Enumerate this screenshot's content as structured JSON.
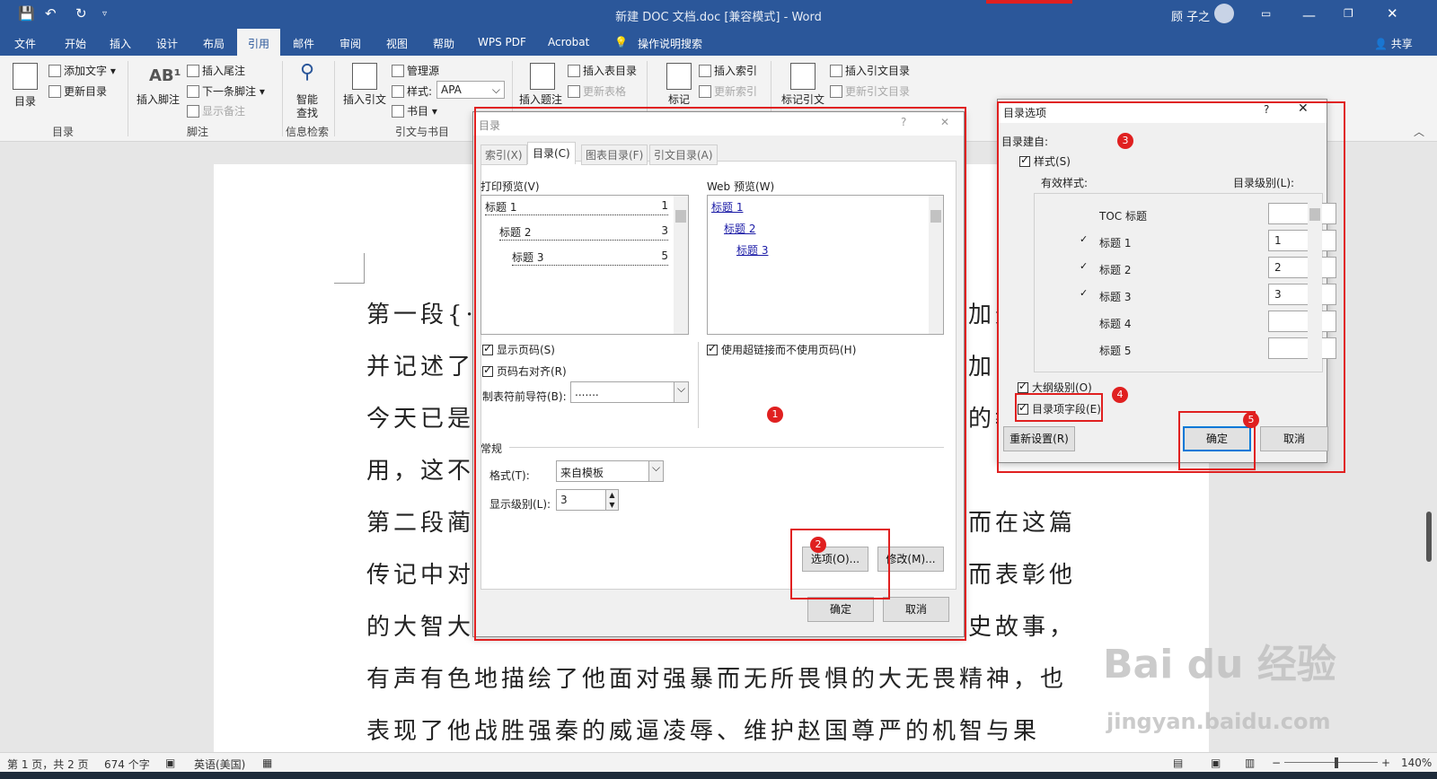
{
  "titlebar": {
    "title": "新建 DOC 文档.doc [兼容模式]  -  Word",
    "user": "顾 子之"
  },
  "menu": [
    "文件",
    "开始",
    "插入",
    "设计",
    "布局",
    "引用",
    "邮件",
    "审阅",
    "视图",
    "帮助",
    "WPS PDF",
    "Acrobat",
    "操作说明搜索"
  ],
  "share": "共享",
  "ribbon": {
    "toc": "目录",
    "add_text": "添加文字",
    "update_toc": "更新目录",
    "g_toc": "目录",
    "insert_footnote": "插入脚注",
    "insert_endnote": "插入尾注",
    "next_footnote": "下一条脚注",
    "show_notes": "显示备注",
    "g_footnote": "脚注",
    "smart1": "智能",
    "smart2": "查找",
    "g_research": "信息检索",
    "insert_citation": "插入引文",
    "manage_sources": "管理源",
    "style_label": "样式:",
    "style_value": "APA",
    "bibliography": "书目",
    "g_citation": "引文与书目",
    "insert_caption": "插入题注",
    "insert_tof": "插入表目录",
    "update_table": "更新表格",
    "mark": "标记",
    "insert_index": "插入索引",
    "update_index": "更新索引",
    "mark_citation": "标记引文",
    "insert_toa": "插入引文目录",
    "update_toa": "更新引文目录"
  },
  "doc_lines": [
    "第一段{·",
    "并记述了",
    "今天已是",
    "用，这不",
    "第二段蔺",
    "传记中对",
    "的大智大",
    "有声有色地描绘了他面对强暴而无所畏惧的大无畏精神，也",
    "表现了他战胜强秦的威逼凌辱、维护赵国尊严的机智与果"
  ],
  "doc_right": [
    "加光",
    "加的",
    "的教",
    "而在这篇",
    "而表彰他",
    "史故事，"
  ],
  "status": {
    "page": "第 1 页，共 2 页",
    "words": "674 个字",
    "lang": "英语(美国)",
    "zoom": "140%"
  },
  "toc_dialog": {
    "title": "目录",
    "tabs": [
      "索引(X)",
      "目录(C)",
      "图表目录(F)",
      "引文目录(A)"
    ],
    "print_preview": "打印预览(V)",
    "web_preview": "Web 预览(W)",
    "print_items": [
      {
        "t": "标题 1",
        "p": "1"
      },
      {
        "t": "标题 2",
        "p": "3"
      },
      {
        "t": "标题 3",
        "p": "5"
      }
    ],
    "web_items": [
      "标题 1",
      "标题 2",
      "标题 3"
    ],
    "show_page": "显示页码(S)",
    "align_right": "页码右对齐(R)",
    "tab_leader": "制表符前导符(B):",
    "leader_value": ".......",
    "use_links": "使用超链接而不使用页码(H)",
    "general": "常规",
    "format_label": "格式(T):",
    "format_value": "来自模板",
    "levels_label": "显示级别(L):",
    "levels_value": "3",
    "options_btn": "选项(O)...",
    "modify_btn": "修改(M)...",
    "ok": "确定",
    "cancel": "取消"
  },
  "options_dialog": {
    "title": "目录选项",
    "build_from": "目录建自:",
    "styles_chk": "样式(S)",
    "available": "有效样式:",
    "level_hdr": "目录级别(L):",
    "rows": [
      {
        "name": "TOC 标题",
        "lvl": "",
        "tick": false
      },
      {
        "name": "标题 1",
        "lvl": "1",
        "tick": true
      },
      {
        "name": "标题 2",
        "lvl": "2",
        "tick": true
      },
      {
        "name": "标题 3",
        "lvl": "3",
        "tick": true
      },
      {
        "name": "标题 4",
        "lvl": "",
        "tick": false
      },
      {
        "name": "标题 5",
        "lvl": "",
        "tick": false
      }
    ],
    "outline": "大纲级别(O)",
    "entry_fields": "目录项字段(E)",
    "reset": "重新设置(R)",
    "ok": "确定",
    "cancel": "取消"
  },
  "badges": [
    "1",
    "2",
    "3",
    "4",
    "5"
  ],
  "watermark": {
    "logo": "Bai du 经验",
    "url": "jingyan.baidu.com"
  },
  "colors": {
    "accent": "#2b579a",
    "annotation": "#e02020"
  }
}
